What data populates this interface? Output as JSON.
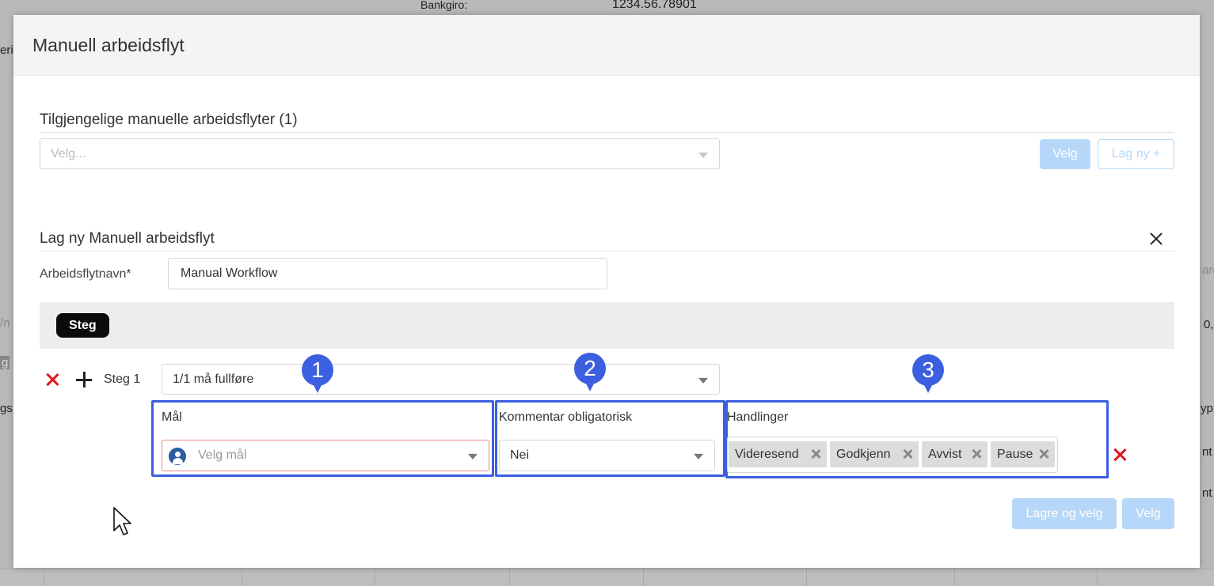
{
  "background": {
    "bankgiro_label": "Bankgiro:",
    "bankgiro_value": "1234.56.78901",
    "left_fragment_1": "eri",
    "left_fragment_2": "/n",
    "left_fragment_3": "g",
    "left_fragment_4": "gs",
    "right_fragment_1": "are",
    "right_fragment_2": "0,",
    "right_fragment_3": "yp",
    "right_fragment_4": "nt",
    "right_fragment_5": "nt"
  },
  "modal": {
    "title": "Manuell arbeidsflyt",
    "available": {
      "title": "Tilgjengelige manuelle arbeidsflyter (1)",
      "select_placeholder": "Velg...",
      "select_button": "Velg",
      "create_button": "Lag ny +"
    },
    "create": {
      "title": "Lag ny Manuell arbeidsflyt",
      "name_label": "Arbeidsflytnavn*",
      "name_value": "Manual Workflow",
      "steps_tab": "Steg",
      "step": {
        "label": "Steg 1",
        "completion_value": "1/1 må fullføre",
        "goal_label": "Mål",
        "goal_placeholder": "Velg mål",
        "comment_label": "Kommentar obligatorisk",
        "comment_value": "Nei",
        "actions_label": "Handlinger",
        "actions": [
          "Videresend",
          "Godkjenn",
          "Avvist",
          "Pause"
        ]
      },
      "save_select_button": "Lagre og velg",
      "select_button": "Velg"
    }
  },
  "markers": [
    "1",
    "2",
    "3"
  ],
  "colors": {
    "highlight": "#3c5fe0",
    "delete_red": "#e0161c",
    "disabled_primary": "#b6d7f7",
    "goal_field_border": "#e88a8a"
  }
}
